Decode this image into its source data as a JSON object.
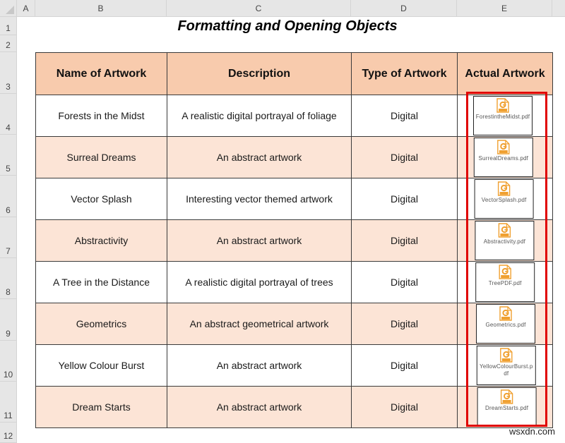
{
  "sheet": {
    "column_headers": [
      "A",
      "B",
      "C",
      "D",
      "E"
    ],
    "row_headers": [
      "1",
      "2",
      "3",
      "4",
      "5",
      "6",
      "7",
      "8",
      "9",
      "10",
      "11",
      "12"
    ],
    "title": "Formatting and Opening Objects"
  },
  "table": {
    "headers": [
      "Name of Artwork",
      "Description",
      "Type of Artwork",
      "Actual Artwork"
    ],
    "rows": [
      {
        "name": "Forests in the Midst",
        "description": "A realistic digital portrayal of  foliage",
        "type": "Digital",
        "object_label": "ForestintheMidst.pdf",
        "object_icon": "pdf-file-icon"
      },
      {
        "name": "Surreal Dreams",
        "description": "An abstract artwork",
        "type": "Digital",
        "object_label": "SurrealDreams.pdf",
        "object_icon": "pdf-file-icon"
      },
      {
        "name": "Vector Splash",
        "description": "Interesting vector themed artwork",
        "type": "Digital",
        "object_label": "VectorSplash.pdf",
        "object_icon": "pdf-file-icon"
      },
      {
        "name": "Abstractivity",
        "description": "An abstract artwork",
        "type": "Digital",
        "object_label": "Abstractivity.pdf",
        "object_icon": "pdf-file-icon"
      },
      {
        "name": "A Tree in the Distance",
        "description": "A realistic digital portrayal of trees",
        "type": "Digital",
        "object_label": "TreePDF.pdf",
        "object_icon": "pdf-file-icon"
      },
      {
        "name": "Geometrics",
        "description": "An abstract geometrical artwork",
        "type": "Digital",
        "object_label": "Geometrics.pdf",
        "object_icon": "pdf-file-icon"
      },
      {
        "name": "Yellow Colour Burst",
        "description": "An abstract artwork",
        "type": "Digital",
        "object_label": "YellowColourBurst.pdf",
        "object_icon": "pdf-file-icon"
      },
      {
        "name": "Dream Starts",
        "description": "An abstract artwork",
        "type": "Digital",
        "object_label": "DreamStarts.pdf",
        "object_icon": "pdf-file-icon"
      }
    ]
  },
  "colors": {
    "header_fill": "#f8cbad",
    "alt_row_fill": "#fce4d6",
    "highlight_border": "#e00000",
    "pdf_icon": "#f0a030"
  },
  "watermark": "wsxdn.com"
}
